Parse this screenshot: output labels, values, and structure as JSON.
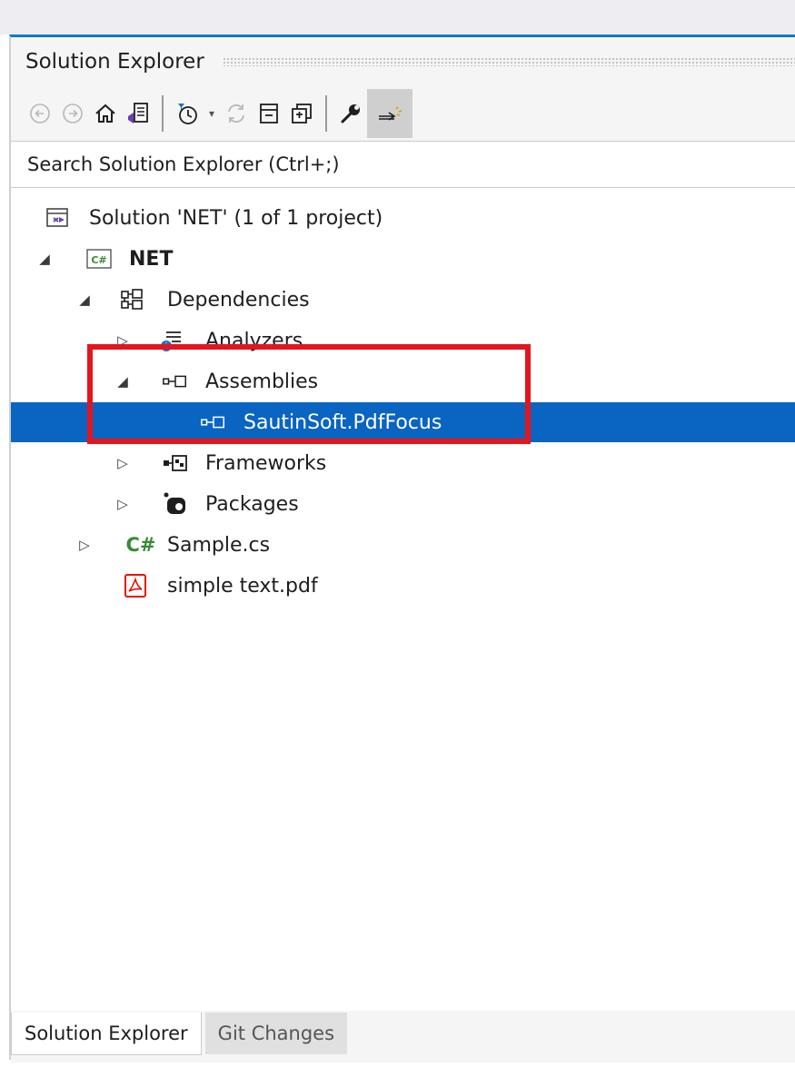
{
  "panel": {
    "title": "Solution Explorer"
  },
  "toolbar": {
    "buttons": [
      {
        "icon": "back-arrow-icon",
        "enabled": false
      },
      {
        "icon": "forward-arrow-icon",
        "enabled": false
      },
      {
        "icon": "home-icon",
        "enabled": true
      },
      {
        "icon": "switch-views-icon",
        "enabled": true
      },
      {
        "icon": "pending-changes-filter-icon",
        "enabled": true
      },
      {
        "icon": "sync-icon",
        "enabled": false
      },
      {
        "icon": "collapse-all-icon",
        "enabled": true
      },
      {
        "icon": "show-all-files-icon",
        "enabled": true
      },
      {
        "icon": "properties-wrench-icon",
        "enabled": true
      },
      {
        "icon": "preview-selected-items-icon",
        "enabled": true,
        "active": true
      }
    ]
  },
  "search": {
    "placeholder": "Search Solution Explorer (Ctrl+;)"
  },
  "tree": {
    "solution": "Solution 'NET' (1 of 1 project)",
    "project": "NET",
    "dependencies": "Dependencies",
    "analyzers": "Analyzers",
    "assemblies": "Assemblies",
    "sautinsoft": "SautinSoft.PdfFocus",
    "frameworks": "Frameworks",
    "packages": "Packages",
    "sample_cs": "Sample.cs",
    "simple_pdf": "simple text.pdf",
    "csharp_glyph": "C#",
    "cs_badge": "C#"
  },
  "colors": {
    "accent": "#007acc",
    "selection": "#0a64c2",
    "highlight_box": "#e3161e",
    "csharp_green": "#388a34",
    "pdf_red": "#e51400"
  },
  "bottom_tabs": [
    {
      "label": "Solution Explorer",
      "active": true
    },
    {
      "label": "Git Changes",
      "active": false
    }
  ]
}
